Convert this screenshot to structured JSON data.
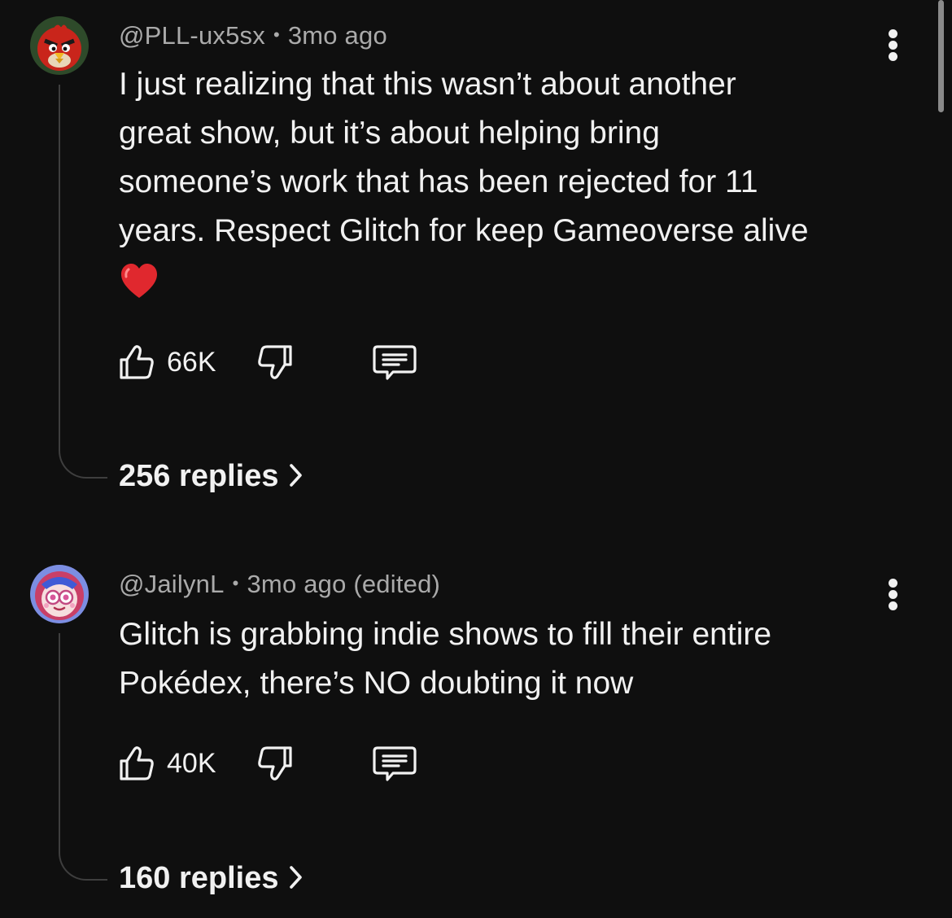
{
  "comments": [
    {
      "author": "@PLL-ux5sx",
      "separator": "•",
      "time": "3mo ago",
      "lines": [
        "I just realizing that this wasn’t about another",
        "great show, but it’s about helping bring",
        "someone’s work that has been rejected for 11",
        "years. Respect Glitch for keep Gameoverse alive"
      ],
      "emoji": "red-heart",
      "likes": "66K",
      "replies": "256 replies",
      "avatar_colors": {
        "bg": "#2e4a2a",
        "accent": "#d42a1f"
      }
    },
    {
      "author": "@JailynL",
      "separator": "•",
      "time": "3mo ago (edited)",
      "lines": [
        "Glitch is grabbing indie shows to fill their entire",
        "Pokédex, there’s NO doubting it now"
      ],
      "likes": "40K",
      "replies": "160 replies",
      "avatar_colors": {
        "bg": "#6b7bd8",
        "accent": "#f3a9c8"
      }
    }
  ],
  "icons": {
    "like": "thumbs-up-icon",
    "dislike": "thumbs-down-icon",
    "reply": "comment-icon",
    "more": "more-vertical-icon",
    "expand": "chevron-right-icon"
  },
  "colors": {
    "background": "#0f0f0f",
    "text": "#f1f1f1",
    "meta": "#aaaaaa",
    "thread": "#3e3e3e"
  }
}
